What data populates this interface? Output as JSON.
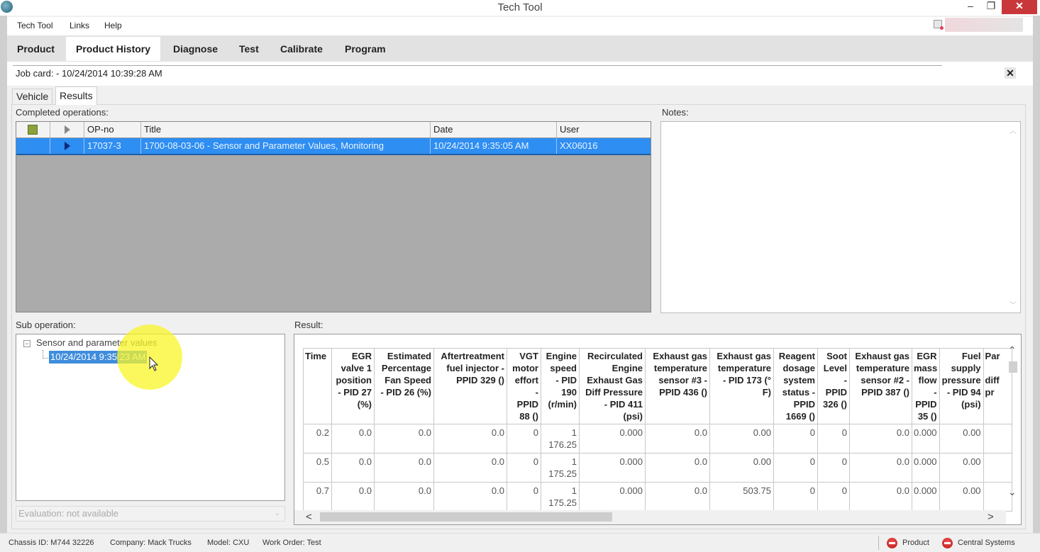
{
  "window": {
    "title": "Tech Tool",
    "minimize": "–",
    "maximize": "❐",
    "close": "✕"
  },
  "menu": {
    "items": [
      "Tech Tool",
      "Links",
      "Help"
    ]
  },
  "main_tabs": [
    {
      "label": "Product",
      "active": false
    },
    {
      "label": "Product History",
      "active": true
    },
    {
      "label": "Diagnose",
      "active": false
    },
    {
      "label": "Test",
      "active": false
    },
    {
      "label": "Calibrate",
      "active": false
    },
    {
      "label": "Program",
      "active": false
    }
  ],
  "job_card": {
    "text": "Job card: -  10/24/2014 10:39:28 AM",
    "close": "✕"
  },
  "sub_tabs": [
    {
      "label": "Vehicle",
      "active": false
    },
    {
      "label": "Results",
      "active": true
    }
  ],
  "completed_operations": {
    "label": "Completed operations:",
    "columns": [
      "",
      "",
      "OP-no",
      "Title",
      "Date",
      "User"
    ],
    "rows": [
      {
        "op_no": "17037-3",
        "title": "1700-08-03-06 - Sensor and Parameter Values, Monitoring",
        "date": "10/24/2014 9:35:05 AM",
        "user": "XX06016",
        "selected": true
      }
    ]
  },
  "notes": {
    "label": "Notes:",
    "value": ""
  },
  "sub_operation": {
    "label": "Sub operation:",
    "tree_toggle": "−",
    "parent": "Sensor and parameter values",
    "child": "10/24/2014 9:35:23 AM"
  },
  "evaluation": {
    "value": "Evaluation: not available",
    "chevron": "⌄"
  },
  "result": {
    "label": "Result:",
    "columns": [
      "Time",
      "EGR valve 1 position - PID 27 (%)",
      "Estimated Percentage Fan Speed - PID 26 (%)",
      "Aftertreatment fuel injector - PPID 329 ()",
      "VGT motor effort - PPID 88 ()",
      "Engine speed - PID 190 (r/min)",
      "Recirculated Engine Exhaust Gas Diff Pressure - PID 411 (psi)",
      "Exhaust gas temperature sensor #3 - PPID 436 ()",
      "Exhaust gas temperature - PID 173 (°F)",
      "Reagent dosage system status - PPID 1669 ()",
      "Soot Level - PPID 326 ()",
      "Exhaust gas temperature sensor #2 - PPID 387 ()",
      "EGR mass flow - PPID 35 ()",
      "Fuel supply pressure - PID 94 (psi)",
      "Par... diff... pr..."
    ],
    "header_html_lines": [
      [
        "Time"
      ],
      [
        "EGR",
        "valve 1",
        "position",
        "- PID 27",
        "(%)"
      ],
      [
        "Estimated",
        "Percentage",
        "Fan Speed",
        "- PID 26 (%)"
      ],
      [
        "Aftertreatment",
        "fuel injector -",
        "PPID 329 ()"
      ],
      [
        "VGT",
        "motor",
        "effort",
        "-",
        "PPID",
        "88 ()"
      ],
      [
        "Engine",
        "speed",
        "- PID",
        "190",
        "(r/min)"
      ],
      [
        "Recirculated",
        "Engine",
        "Exhaust Gas",
        "Diff Pressure",
        "- PID 411",
        "(psi)"
      ],
      [
        "Exhaust gas",
        "temperature",
        "sensor #3 -",
        "PPID 436 ()"
      ],
      [
        "Exhaust gas",
        "temperature",
        "- PID 173 (°",
        "F)"
      ],
      [
        "Reagent",
        "dosage",
        "system",
        "status -",
        "PPID",
        "1669 ()"
      ],
      [
        "Soot",
        "Level",
        "-",
        "PPID",
        "326 ()"
      ],
      [
        "Exhaust gas",
        "temperature",
        "sensor #2 -",
        "PPID 387 ()"
      ],
      [
        "EGR",
        "mass",
        "flow",
        "-",
        "PPID",
        "35 ()"
      ],
      [
        "Fuel",
        "supply",
        "pressure",
        "- PID 94",
        "(psi)"
      ],
      [
        "Par",
        "",
        "diff",
        "pr"
      ]
    ],
    "rows": [
      [
        "0.2",
        "0.0",
        "0.0",
        "0.0",
        "0",
        "1\n176.25",
        "0.000",
        "0.0",
        "0.00",
        "0",
        "0",
        "0.0",
        "0.000",
        "0.00",
        ""
      ],
      [
        "0.5",
        "0.0",
        "0.0",
        "0.0",
        "0",
        "1\n175.25",
        "0.000",
        "0.0",
        "0.00",
        "0",
        "0",
        "0.0",
        "0.000",
        "0.00",
        ""
      ],
      [
        "0.7",
        "0.0",
        "0.0",
        "0.0",
        "0",
        "1\n175.25",
        "0.000",
        "0.0",
        "503.75",
        "0",
        "0",
        "0.0",
        "0.000",
        "0.00",
        ""
      ]
    ],
    "scroll": {
      "up": "⌃",
      "down": "⌄",
      "left": "<",
      "right": ">"
    }
  },
  "status_bar": {
    "chassis": "Chassis ID: M744 32226",
    "company": "Company: Mack Trucks",
    "model": "Model: CXU",
    "work_order": "Work Order: Test",
    "indicators": [
      {
        "label": "Product",
        "status": "stopped",
        "color": "#d02020"
      },
      {
        "label": "Central Systems",
        "status": "stopped",
        "color": "#d02020"
      }
    ]
  },
  "colors": {
    "selection": "#2e8ef2",
    "tree_selection": "#3f8ddc",
    "close_button": "#c8383b",
    "grid_background": "#ababab"
  }
}
